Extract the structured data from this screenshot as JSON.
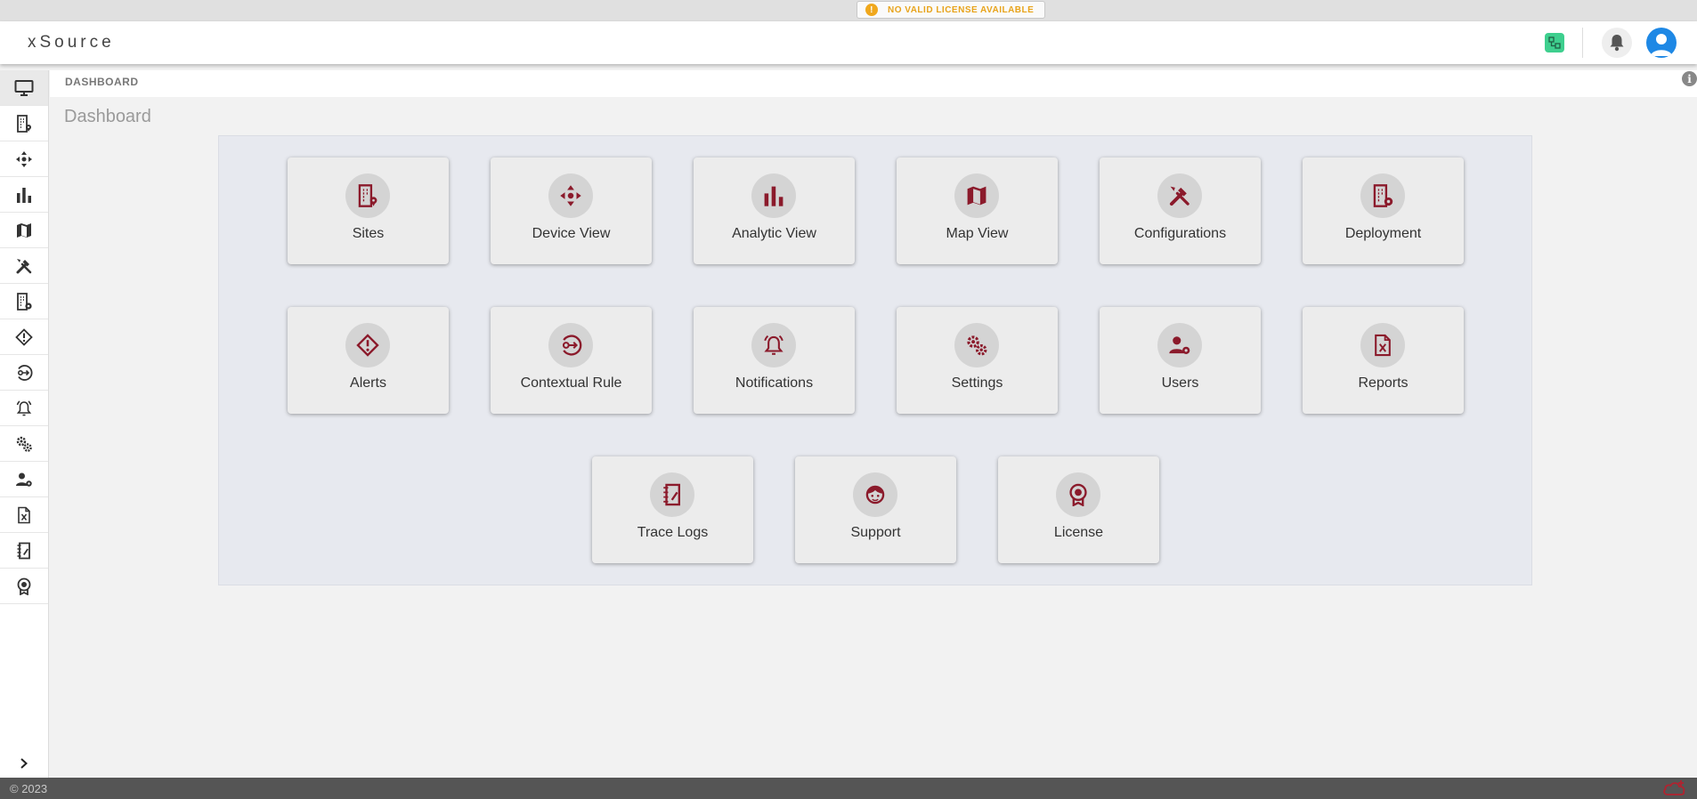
{
  "license_banner": {
    "text": "NO VALID LICENSE AVAILABLE",
    "icon": "warning-icon",
    "color": "#e8a31a"
  },
  "header": {
    "brand": "xSource",
    "icons": [
      "network-status-icon",
      "bell-icon",
      "user-avatar-icon"
    ],
    "status_color": "#3ecf8e",
    "avatar_color": "#1e88e5"
  },
  "sidebar": {
    "items": [
      {
        "name": "dashboard",
        "icon": "monitor-icon",
        "active": true
      },
      {
        "name": "sites",
        "icon": "building-pin-icon"
      },
      {
        "name": "device-view",
        "icon": "move-arrows-icon"
      },
      {
        "name": "analytic-view",
        "icon": "bar-chart-icon"
      },
      {
        "name": "map-view",
        "icon": "map-icon"
      },
      {
        "name": "configurations",
        "icon": "tools-icon"
      },
      {
        "name": "deployment",
        "icon": "building-gear-icon"
      },
      {
        "name": "alerts",
        "icon": "diamond-alert-icon"
      },
      {
        "name": "contextual-rule",
        "icon": "circle-arrow-icon"
      },
      {
        "name": "notifications",
        "icon": "bell-ring-icon"
      },
      {
        "name": "settings",
        "icon": "gears-icon"
      },
      {
        "name": "users",
        "icon": "user-gear-icon"
      },
      {
        "name": "reports",
        "icon": "excel-file-icon"
      },
      {
        "name": "trace-logs",
        "icon": "notebook-pen-icon"
      },
      {
        "name": "license",
        "icon": "award-icon"
      }
    ],
    "expand_icon": "chevron-right-icon"
  },
  "breadcrumb": "DASHBOARD",
  "page_title": "Dashboard",
  "accent_color": "#8b1a2b",
  "tiles": [
    {
      "label": "Sites",
      "icon": "building-pin-icon"
    },
    {
      "label": "Device View",
      "icon": "move-arrows-icon"
    },
    {
      "label": "Analytic View",
      "icon": "bar-chart-icon"
    },
    {
      "label": "Map View",
      "icon": "map-icon"
    },
    {
      "label": "Configurations",
      "icon": "tools-icon"
    },
    {
      "label": "Deployment",
      "icon": "building-gear-icon"
    },
    {
      "label": "Alerts",
      "icon": "diamond-alert-icon"
    },
    {
      "label": "Contextual Rule",
      "icon": "circle-arrow-icon"
    },
    {
      "label": "Notifications",
      "icon": "bell-ring-icon"
    },
    {
      "label": "Settings",
      "icon": "gears-icon"
    },
    {
      "label": "Users",
      "icon": "user-gear-icon"
    },
    {
      "label": "Reports",
      "icon": "excel-file-icon"
    },
    {
      "label": "Trace Logs",
      "icon": "notebook-pen-icon"
    },
    {
      "label": "Support",
      "icon": "support-agent-icon"
    },
    {
      "label": "License",
      "icon": "award-icon"
    }
  ],
  "footer": {
    "copyright": "© 2023",
    "icon": "cloud-icon"
  }
}
